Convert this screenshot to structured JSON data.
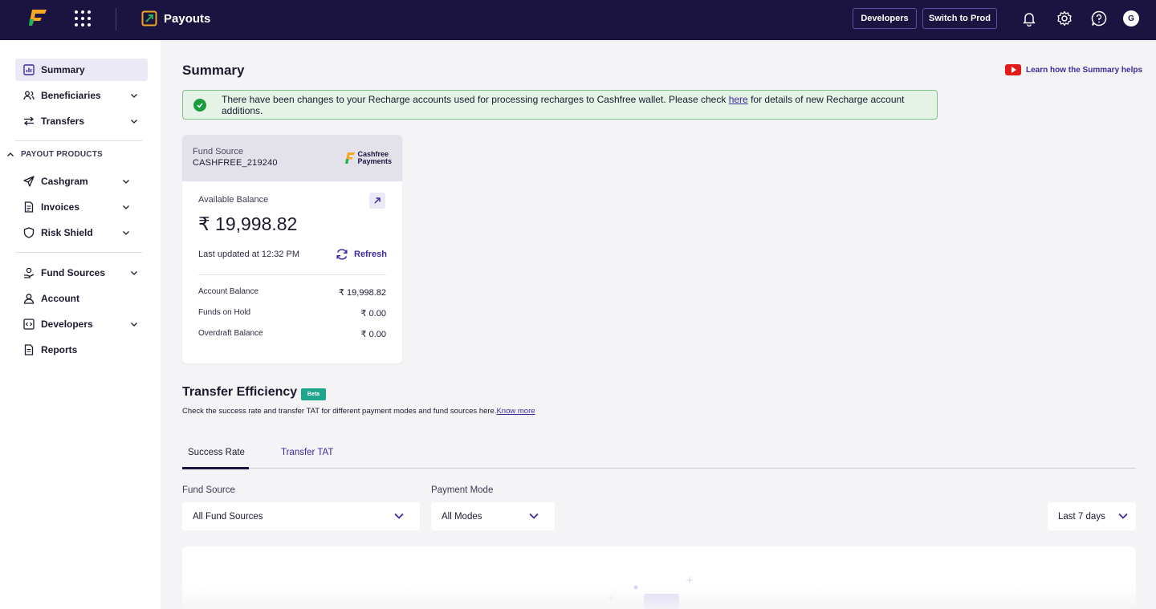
{
  "header": {
    "product_name": "Payouts",
    "developers_label": "Developers",
    "switch_label": "Switch to Prod",
    "avatar_initial": "G"
  },
  "sidebar": {
    "items_top": [
      {
        "label": "Summary",
        "icon": "chart-icon"
      },
      {
        "label": "Beneficiaries",
        "icon": "users-icon"
      },
      {
        "label": "Transfers",
        "icon": "transfer-arrows-icon"
      }
    ],
    "section_label": "PAYOUT PRODUCTS",
    "items_products": [
      {
        "label": "Cashgram",
        "icon": "paper-plane-icon"
      },
      {
        "label": "Invoices",
        "icon": "invoice-icon"
      },
      {
        "label": "Risk Shield",
        "icon": "shield-icon"
      }
    ],
    "items_bottom": [
      {
        "label": "Fund Sources",
        "icon": "money-hand-icon"
      },
      {
        "label": "Account",
        "icon": "user-icon"
      },
      {
        "label": "Developers",
        "icon": "code-icon"
      },
      {
        "label": "Reports",
        "icon": "document-icon"
      }
    ]
  },
  "main": {
    "title": "Summary",
    "learn_link": "Learn how the Summary helps",
    "banner": {
      "text_before": "There have been changes to your Recharge accounts used for processing recharges to Cashfree wallet. Please check ",
      "link": "here",
      "text_after": " for details of new Recharge account additions."
    },
    "fund_card": {
      "source_label": "Fund Source",
      "source_value": "CASHFREE_219240",
      "logo_line1": "Cashfree",
      "logo_line2": "Payments",
      "available_label": "Available Balance",
      "available_value": "₹ 19,998.82",
      "last_updated": "Last updated at 12:32 PM",
      "refresh_label": "Refresh",
      "rows": [
        {
          "label": "Account Balance",
          "value": "₹ 19,998.82"
        },
        {
          "label": "Funds on Hold",
          "value": "₹ 0.00"
        },
        {
          "label": "Overdraft Balance",
          "value": "₹ 0.00"
        }
      ]
    },
    "transfer_efficiency": {
      "title": "Transfer Efficiency",
      "badge": "Beta",
      "description": "Check the success rate and transfer TAT for different payment modes and fund sources here.",
      "know_more": "Know more",
      "tabs": [
        "Success Rate",
        "Transfer TAT"
      ],
      "fund_source_label": "Fund Source",
      "fund_source_value": "All Fund Sources",
      "payment_mode_label": "Payment Mode",
      "payment_mode_value": "All Modes",
      "date_range_value": "Last 7 days"
    }
  },
  "colors": {
    "topbar": "#1b1440",
    "accent": "#3d2aa0",
    "success": "#1a9b3c",
    "beta": "#1ea58a"
  }
}
